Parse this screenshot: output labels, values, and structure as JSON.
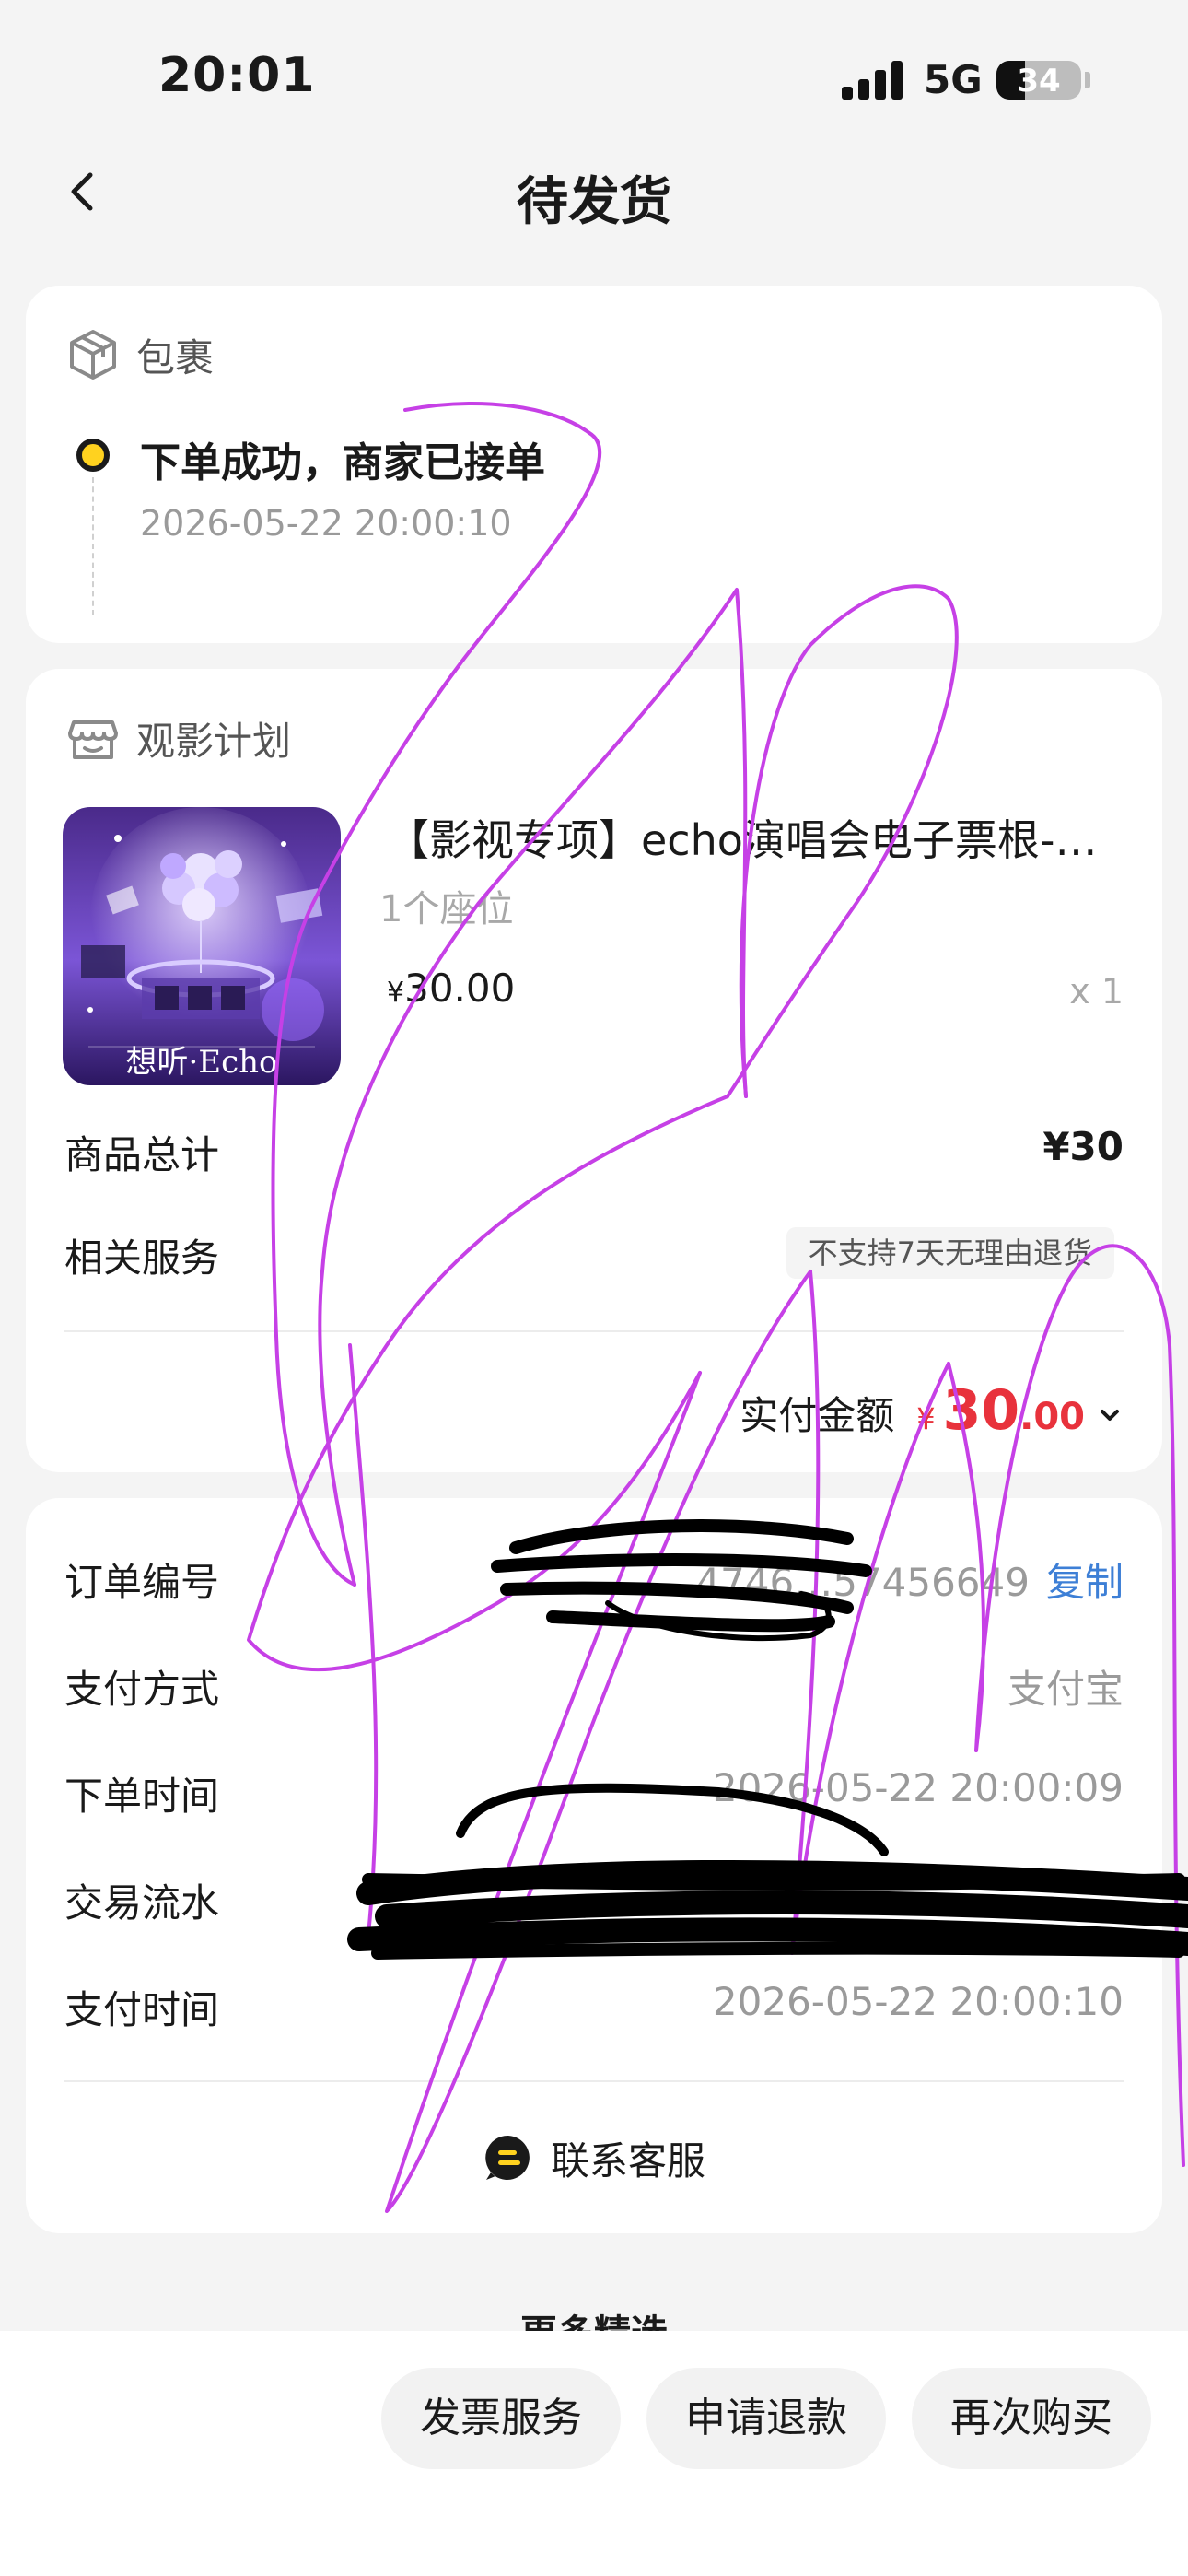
{
  "status_bar": {
    "time": "20:01",
    "network": "5G",
    "battery_level": "34"
  },
  "header": {
    "title": "待发货"
  },
  "package": {
    "section_title": "包裹",
    "status_title": "下单成功，商家已接单",
    "status_time": "2026-05-22 20:00:10"
  },
  "order": {
    "section_title": "观影计划",
    "product": {
      "title": "【影视专项】echo演唱会电子票根-…",
      "spec": "1个座位",
      "price_currency": "¥",
      "price": "30.00",
      "quantity": "x 1",
      "image_caption": "想听·Echo"
    },
    "total_label": "商品总计",
    "total_value": "¥30",
    "service_label": "相关服务",
    "service_badge": "不支持7天无理由退货",
    "paid_label": "实付金额",
    "paid_currency": "¥",
    "paid_int": "30",
    "paid_decimal": ".00"
  },
  "order_info": {
    "order_no_label": "订单编号",
    "order_no_value": "…4746…57456649",
    "copy_label": "复制",
    "pay_method_label": "支付方式",
    "pay_method_value": "支付宝",
    "order_time_label": "下单时间",
    "order_time_value": "2026-05-22 20:00:09",
    "trade_no_label": "交易流水",
    "trade_no_value": "",
    "pay_time_label": "支付时间",
    "pay_time_value": "2026-05-22 20:00:10",
    "contact_label": "联系客服"
  },
  "more_section_title": "更多精选",
  "bottom_bar": {
    "invoice_label": "发票服务",
    "refund_label": "申请退款",
    "rebuy_label": "再次购买"
  },
  "colors": {
    "accent_red": "#e8323c",
    "status_yellow": "#ffd21f",
    "link_blue": "#3d7fd6",
    "scribble_magenta": "#c640e6",
    "redaction_black": "#000000"
  }
}
